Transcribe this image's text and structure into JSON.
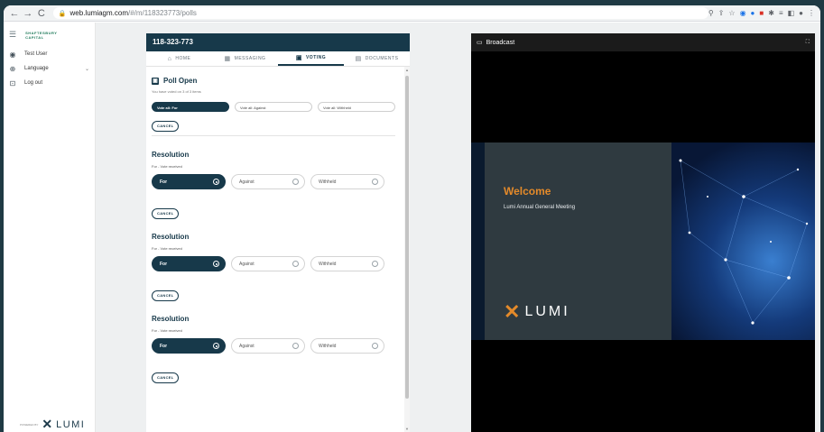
{
  "browser": {
    "url_host": "web.lumiagm.com",
    "url_path": "/#/m/118323773/polls"
  },
  "sidebar": {
    "brand_line1": "SHAFTESBURY",
    "brand_line2": "CAPITAL",
    "items": [
      {
        "label": "Test User",
        "icon": "user-icon"
      },
      {
        "label": "Language",
        "icon": "globe-icon"
      },
      {
        "label": "Log out",
        "icon": "logout-icon"
      }
    ],
    "powered_by": "POWERED BY",
    "footer_logo": "LUMI"
  },
  "panel": {
    "meeting_id": "118-323-773",
    "tabs": [
      {
        "label": "HOME",
        "icon": "home-icon"
      },
      {
        "label": "MESSAGING",
        "icon": "chat-icon"
      },
      {
        "label": "VOTING",
        "icon": "voting-icon"
      },
      {
        "label": "DOCUMENTS",
        "icon": "document-icon"
      }
    ],
    "active_tab": "VOTING",
    "poll_title": "Poll Open",
    "voted_note": "You have voted on 3 of 3 items",
    "vote_all": [
      "Vote all: For",
      "Vote all: Against",
      "Vote all: Withheld"
    ],
    "cancel_label": "CANCEL",
    "resolutions": [
      {
        "title": "Resolution",
        "status": "For - Vote received",
        "choices": [
          "For",
          "Against",
          "Withheld"
        ],
        "selected": "For",
        "cancel": "CANCEL"
      },
      {
        "title": "Resolution",
        "status": "For - Vote received",
        "choices": [
          "For",
          "Against",
          "Withheld"
        ],
        "selected": "For",
        "cancel": "CANCEL"
      },
      {
        "title": "Resolution",
        "status": "For - Vote received",
        "choices": [
          "For",
          "Against",
          "Withheld"
        ],
        "selected": "For",
        "cancel": "CANCEL"
      }
    ]
  },
  "broadcast": {
    "title": "Broadcast",
    "welcome": "Welcome",
    "subtitle": "Lumi Annual General Meeting",
    "logo_text": "LUMI"
  },
  "colors": {
    "navy": "#17394a",
    "accent_orange": "#e48a2a"
  }
}
